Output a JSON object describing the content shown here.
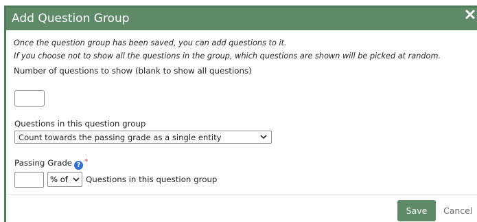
{
  "dialog": {
    "title": "Add Question Group",
    "close_label": "close",
    "intro_line_1": "Once the question group has been saved, you can add questions to it.",
    "intro_line_2": "If you choose not to show all the questions in the group, which questions are shown will be picked at random.",
    "num_questions_label": "Number of questions to show (blank to show all questions)",
    "num_questions_value": "",
    "questions_group_label": "Questions in this question group",
    "questions_group_selected": "Count towards the passing grade as a single entity",
    "passing_grade_label": "Passing Grade",
    "help_icon_glyph": "?",
    "required_marker": "*",
    "passing_grade_value": "",
    "passing_grade_unit_selected": "% of",
    "passing_grade_suffix": "Questions in this question group",
    "save_label": "Save",
    "cancel_label": "Cancel"
  },
  "colors": {
    "header": "#5e8a68",
    "border": "#4f7b5b",
    "help": "#2f6fd1",
    "required": "#d22020"
  },
  "icons": {
    "close": "close-icon",
    "help": "help-icon",
    "dropdown": "chevron-down-icon"
  }
}
